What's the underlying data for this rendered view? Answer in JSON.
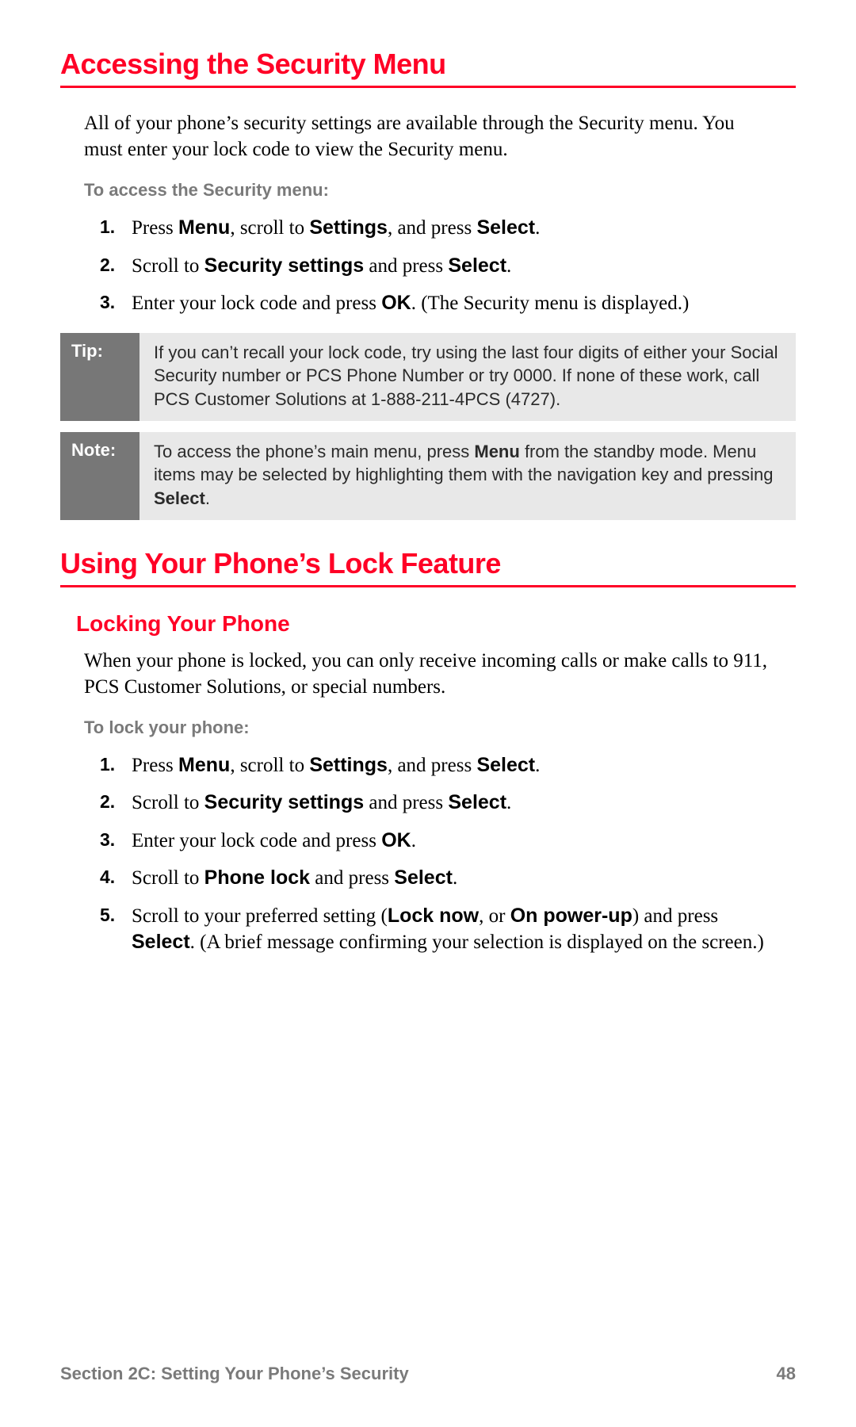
{
  "heading1": "Accessing the Security Menu",
  "intro1": "All of your phone’s security settings are available through the Security menu. You must enter your lock code to view the Security menu.",
  "sub1": "To access the Security menu:",
  "steps1": {
    "s1a": "Press ",
    "s1b": "Menu",
    "s1c": ", scroll to ",
    "s1d": "Settings",
    "s1e": ", and press ",
    "s1f": "Select",
    "s1g": ".",
    "s2a": "Scroll to ",
    "s2b": "Security settings",
    "s2c": " and press ",
    "s2d": "Select",
    "s2e": ".",
    "s3a": "Enter your lock code and press ",
    "s3b": "OK",
    "s3c": ". (The Security menu is displayed.)"
  },
  "tip": {
    "label": "Tip:",
    "text": "If you can’t recall your lock code, try using the last four digits of either your Social Security number or PCS Phone Number or try 0000. If none of these work, call PCS Customer Solutions at 1-888-211-4PCS (4727)."
  },
  "note": {
    "label": "Note:",
    "t1": "To access the phone’s main menu, press ",
    "t2": "Menu",
    "t3": " from the standby mode. Menu items may be selected by highlighting them with the navigation key and pressing ",
    "t4": "Select",
    "t5": "."
  },
  "heading2": "Using Your Phone’s Lock Feature",
  "heading2_sub": "Locking Your Phone",
  "intro2": "When your phone is locked, you can only receive incoming calls or make calls to 911, PCS Customer Solutions, or special numbers.",
  "sub2": "To lock your phone:",
  "steps2": {
    "s1a": "Press ",
    "s1b": "Menu",
    "s1c": ", scroll to ",
    "s1d": "Settings",
    "s1e": ", and press ",
    "s1f": "Select",
    "s1g": ".",
    "s2a": "Scroll to ",
    "s2b": "Security settings",
    "s2c": " and press ",
    "s2d": "Select",
    "s2e": ".",
    "s3a": "Enter your lock code and press ",
    "s3b": "OK",
    "s3c": ".",
    "s4a": "Scroll to ",
    "s4b": "Phone lock",
    "s4c": " and press ",
    "s4d": "Select",
    "s4e": ".",
    "s5a": "Scroll to your preferred setting (",
    "s5b": "Lock now",
    "s5c": ", or ",
    "s5d": "On power-up",
    "s5e": ") and press ",
    "s5f": "Select",
    "s5g": ". (A brief message confirming your selection is displayed on the screen.)"
  },
  "footer": {
    "left": "Section 2C: Setting Your Phone’s Security",
    "right": "48"
  }
}
